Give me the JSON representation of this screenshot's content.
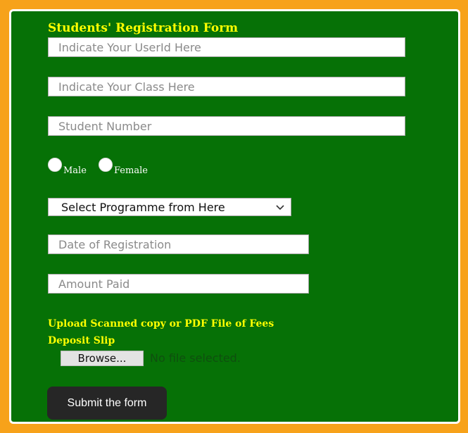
{
  "form": {
    "title": "Students' Registration Form",
    "userid": {
      "placeholder": "Indicate Your UserId Here"
    },
    "class": {
      "placeholder": "Indicate Your Class Here"
    },
    "student_number": {
      "placeholder": "Student Number"
    },
    "gender": {
      "male_label": "Male",
      "female_label": "Female"
    },
    "programme": {
      "selected": "Select Programme from Here"
    },
    "date": {
      "placeholder": "Date of Registration"
    },
    "amount": {
      "placeholder": "Amount Paid"
    },
    "upload": {
      "label": "Upload Scanned copy or PDF File of Fees Deposit Slip",
      "browse_label": "Browse...",
      "status": "No file selected."
    },
    "submit_label": "Submit the form"
  },
  "colors": {
    "page_bg": "#f7a21a",
    "form_bg": "#067106",
    "title": "#ffff00",
    "button": "#262626"
  },
  "icons": {
    "select_arrow": "chevron-down-icon"
  }
}
